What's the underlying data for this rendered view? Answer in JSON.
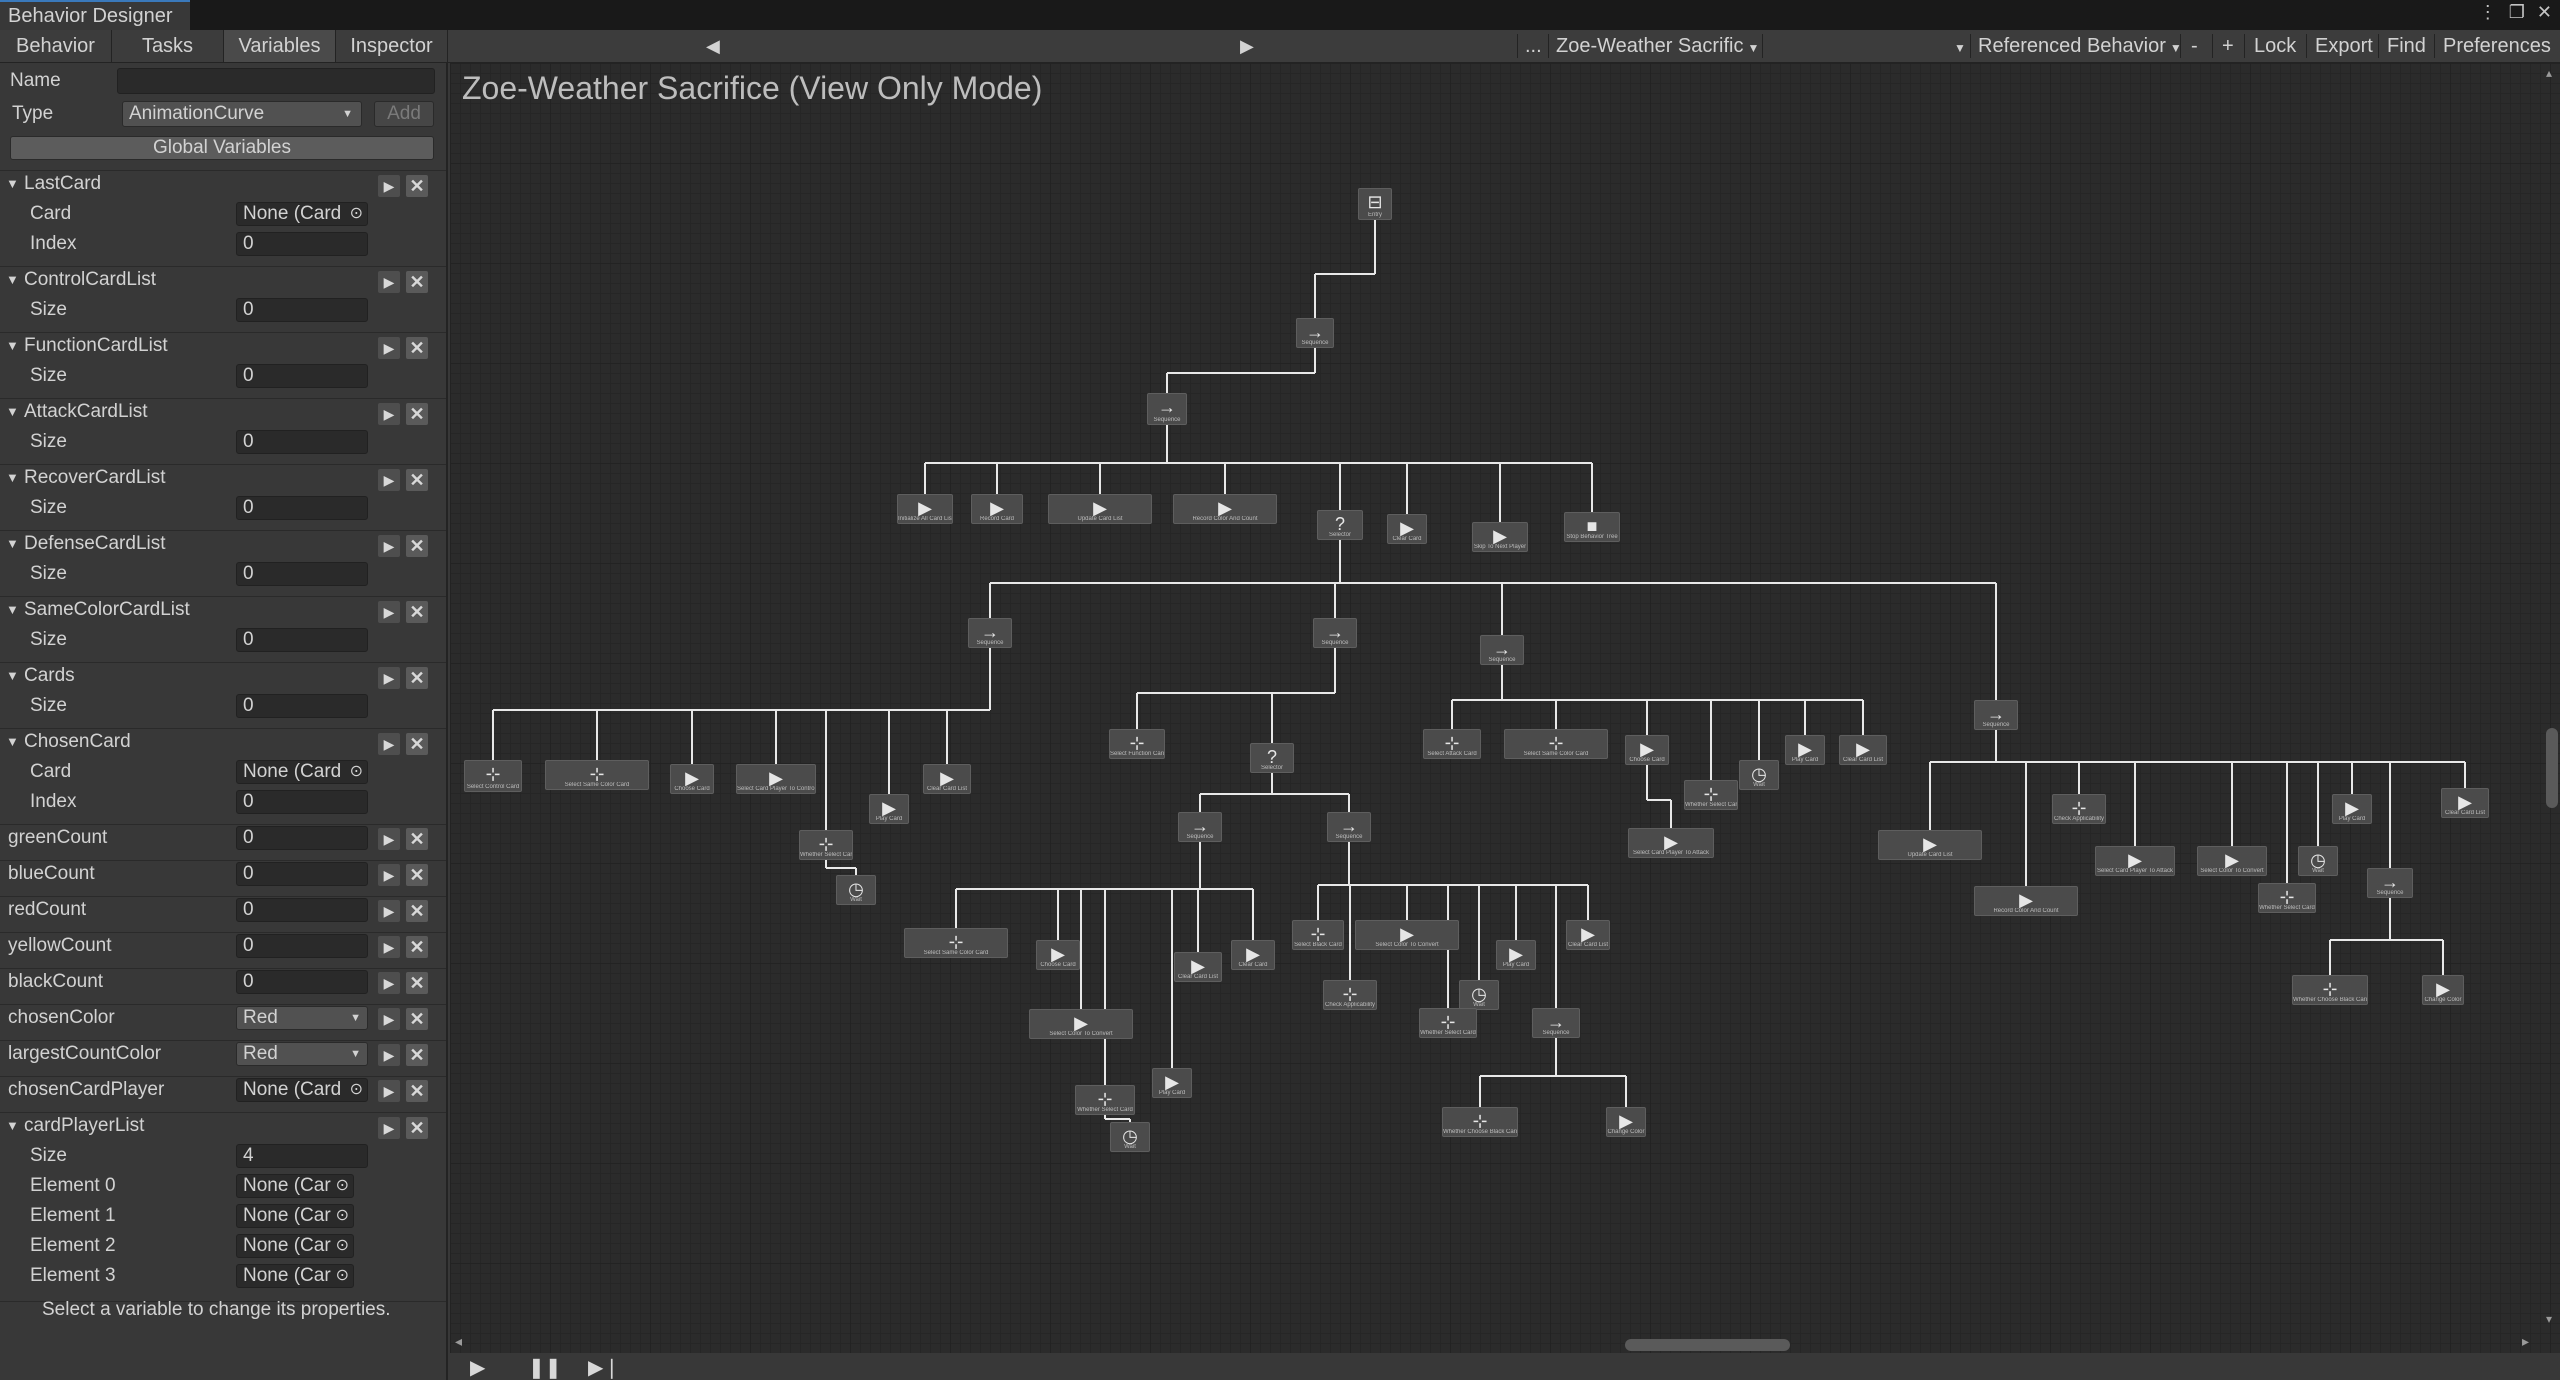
{
  "window": {
    "title": "Behavior Designer"
  },
  "tabs": [
    "Behavior",
    "Tasks",
    "Variables",
    "Inspector"
  ],
  "toolbar": {
    "behavior_select": "Zoe-Weather Sacrific",
    "ellipsis": "...",
    "referenced": "Referenced Behavior",
    "minus": "-",
    "plus": "+",
    "lock": "Lock",
    "export": "Export",
    "find": "Find",
    "preferences": "Preferences"
  },
  "variables_panel": {
    "name_label": "Name",
    "name_value": "",
    "type_label": "Type",
    "type_value": "AnimationCurve",
    "add_label": "Add",
    "global_button": "Global Variables",
    "footer": "Select a variable to change its properties."
  },
  "variables": [
    {
      "name": "LastCard",
      "rows": [
        {
          "label": "Card",
          "value": "None (Card"
        },
        {
          "label": "Index",
          "value": "0"
        }
      ]
    },
    {
      "name": "ControlCardList",
      "rows": [
        {
          "label": "Size",
          "value": "0"
        }
      ]
    },
    {
      "name": "FunctionCardList",
      "rows": [
        {
          "label": "Size",
          "value": "0"
        }
      ]
    },
    {
      "name": "AttackCardList",
      "rows": [
        {
          "label": "Size",
          "value": "0"
        }
      ]
    },
    {
      "name": "RecoverCardList",
      "rows": [
        {
          "label": "Size",
          "value": "0"
        }
      ]
    },
    {
      "name": "DefenseCardList",
      "rows": [
        {
          "label": "Size",
          "value": "0"
        }
      ]
    },
    {
      "name": "SameColorCardList",
      "rows": [
        {
          "label": "Size",
          "value": "0"
        }
      ]
    },
    {
      "name": "Cards",
      "rows": [
        {
          "label": "Size",
          "value": "0"
        }
      ]
    },
    {
      "name": "ChosenCard",
      "rows": [
        {
          "label": "Card",
          "value": "None (Card"
        },
        {
          "label": "Index",
          "value": "0"
        }
      ]
    }
  ],
  "simple_vars": [
    {
      "name": "greenCount",
      "value": "0"
    },
    {
      "name": "blueCount",
      "value": "0"
    },
    {
      "name": "redCount",
      "value": "0"
    },
    {
      "name": "yellowCount",
      "value": "0"
    },
    {
      "name": "blackCount",
      "value": "0"
    },
    {
      "name": "chosenColor",
      "value": "Red"
    },
    {
      "name": "largestCountColor",
      "value": "Red"
    },
    {
      "name": "chosenCardPlayer",
      "value": "None (Card"
    }
  ],
  "card_player_list": {
    "name": "cardPlayerList",
    "size_label": "Size",
    "size_value": "4",
    "elements": [
      {
        "label": "Element 0",
        "value": "None (Car"
      },
      {
        "label": "Element 1",
        "value": "None (Car"
      },
      {
        "label": "Element 2",
        "value": "None (Car"
      },
      {
        "label": "Element 3",
        "value": "None (Car"
      }
    ]
  },
  "graph": {
    "title": "Zoe-Weather Sacrifice (View Only Mode)",
    "nodes": [
      {
        "label": "Entry",
        "glyph": "⊟"
      },
      {
        "label": "Sequence",
        "glyph": "→"
      },
      {
        "label": "Sequence",
        "glyph": "→"
      },
      {
        "label": "Initialize All Card List",
        "glyph": "▶"
      },
      {
        "label": "Record Card",
        "glyph": "▶"
      },
      {
        "label": "Update Card List",
        "glyph": "▶"
      },
      {
        "label": "Record Color And Count",
        "glyph": "▶"
      },
      {
        "label": "Selector",
        "glyph": "?"
      },
      {
        "label": "Clear Card",
        "glyph": "▶"
      },
      {
        "label": "Skip To Next Player",
        "glyph": "▶"
      },
      {
        "label": "Stop Behavior Tree",
        "glyph": "■"
      },
      {
        "label": "Sequence",
        "glyph": "→"
      },
      {
        "label": "Sequence",
        "glyph": "→"
      },
      {
        "label": "Sequence",
        "glyph": "→"
      },
      {
        "label": "Sequence",
        "glyph": "→"
      },
      {
        "label": "Select Control Card",
        "glyph": "⊹"
      },
      {
        "label": "Select Same Color Card",
        "glyph": "⊹"
      },
      {
        "label": "Choose Card",
        "glyph": "▶"
      },
      {
        "label": "Select Card Player To Control",
        "glyph": "▶"
      },
      {
        "label": "Whether Select Card",
        "glyph": "⊹"
      },
      {
        "label": "Play Card",
        "glyph": "▶"
      },
      {
        "label": "Clear Card List",
        "glyph": "▶"
      },
      {
        "label": "Wait",
        "glyph": "◷"
      },
      {
        "label": "Select Function Card",
        "glyph": "⊹"
      },
      {
        "label": "Selector",
        "glyph": "?"
      },
      {
        "label": "Sequence",
        "glyph": "→"
      },
      {
        "label": "Sequence",
        "glyph": "→"
      },
      {
        "label": "Select Attack Card",
        "glyph": "⊹"
      },
      {
        "label": "Select Same Color Card",
        "glyph": "⊹"
      },
      {
        "label": "Choose Card",
        "glyph": "▶"
      },
      {
        "label": "Whether Select Card",
        "glyph": "⊹"
      },
      {
        "label": "Wait",
        "glyph": "◷"
      },
      {
        "label": "Play Card",
        "glyph": "▶"
      },
      {
        "label": "Clear Card List",
        "glyph": "▶"
      },
      {
        "label": "Select Card Player To Attack",
        "glyph": "▶"
      },
      {
        "label": "Sequence",
        "glyph": "→"
      },
      {
        "label": "Update Card List",
        "glyph": "▶"
      },
      {
        "label": "Record Color And Count",
        "glyph": "▶"
      },
      {
        "label": "Check Applicability",
        "glyph": "⊹"
      },
      {
        "label": "Select Card Player To Attack",
        "glyph": "▶"
      },
      {
        "label": "Select Color To Convert",
        "glyph": "▶"
      },
      {
        "label": "Whether Select Card",
        "glyph": "⊹"
      },
      {
        "label": "Wait",
        "glyph": "◷"
      },
      {
        "label": "Play Card",
        "glyph": "▶"
      },
      {
        "label": "Sequence",
        "glyph": "→"
      },
      {
        "label": "Clear Card List",
        "glyph": "▶"
      },
      {
        "label": "Whether Choose Black Card",
        "glyph": "⊹"
      },
      {
        "label": "Change Color",
        "glyph": "▶"
      },
      {
        "label": "Select Same Color Card",
        "glyph": "⊹"
      },
      {
        "label": "Choose Card",
        "glyph": "▶"
      },
      {
        "label": "Clear Card List",
        "glyph": "▶"
      },
      {
        "label": "Clear Card",
        "glyph": "▶"
      },
      {
        "label": "Select Color To Convert",
        "glyph": "▶"
      },
      {
        "label": "Whether Select Card",
        "glyph": "⊹"
      },
      {
        "label": "Play Card",
        "glyph": "▶"
      },
      {
        "label": "Wait",
        "glyph": "◷"
      },
      {
        "label": "Select Black Card",
        "glyph": "⊹"
      },
      {
        "label": "Select Color To Convert",
        "glyph": "▶"
      },
      {
        "label": "Play Card",
        "glyph": "▶"
      },
      {
        "label": "Clear Card List",
        "glyph": "▶"
      },
      {
        "label": "Check Applicability",
        "glyph": "⊹"
      },
      {
        "label": "Wait",
        "glyph": "◷"
      },
      {
        "label": "Whether Select Card",
        "glyph": "⊹"
      },
      {
        "label": "Sequence",
        "glyph": "→"
      },
      {
        "label": "Whether Choose Black Card",
        "glyph": "⊹"
      },
      {
        "label": "Change Color",
        "glyph": "▶"
      }
    ]
  }
}
